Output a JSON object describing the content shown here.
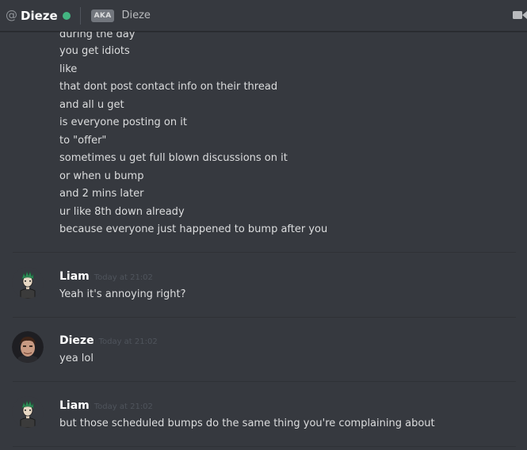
{
  "header": {
    "at_symbol": "@",
    "title": "Dieze",
    "status_color": "#43b581",
    "aka_badge": "AKA",
    "aka_name": "Dieze",
    "icons": [
      "at-icon",
      "online-status-icon",
      "video-call-icon"
    ]
  },
  "prior_lines": [
    "during the day",
    "you get idiots",
    "like",
    "that dont post contact info on their thread",
    "and all u get",
    "is everyone posting on it",
    "to \"offer\"",
    "sometimes u get full blown discussions on it",
    "or when u bump",
    "and 2 mins later",
    "ur like 8th down already",
    "because everyone just happened to bump after you"
  ],
  "messages": [
    {
      "author": "Liam",
      "timestamp": "Today at 21:02",
      "text": "Yeah it's annoying right?"
    },
    {
      "author": "Dieze",
      "timestamp": "Today at 21:02",
      "text": "yea lol"
    },
    {
      "author": "Liam",
      "timestamp": "Today at 21:02",
      "text": "but those scheduled bumps do the same thing you're complaining about"
    }
  ]
}
